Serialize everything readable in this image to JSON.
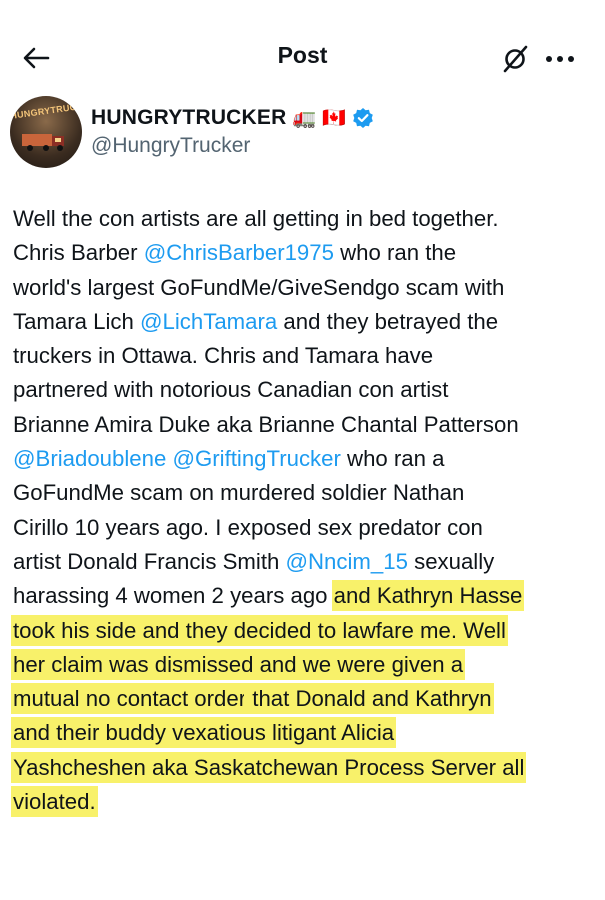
{
  "header": {
    "title": "Post",
    "back_icon": "arrow-left-icon",
    "grok_icon": "grok-icon",
    "more_icon": "more-icon"
  },
  "author": {
    "display_name": "HUNGRYTRUCKER",
    "emoji_truck": "🚛",
    "emoji_flag": "🇨🇦",
    "handle": "@HungryTrucker",
    "avatar_text": "HUNGRYTRUCKER",
    "verified_color": "#1d9bf0"
  },
  "post": {
    "lines": [
      [
        {
          "t": "Well the con artists are all getting in bed together."
        }
      ],
      [
        {
          "t": "Chris Barber "
        },
        {
          "t": "@ChrisBarber1975",
          "m": true
        },
        {
          "t": " who ran the"
        }
      ],
      [
        {
          "t": "world's largest GoFundMe/GiveSendgo scam with"
        }
      ],
      [
        {
          "t": "Tamara Lich "
        },
        {
          "t": "@LichTamara",
          "m": true
        },
        {
          "t": " and they betrayed the"
        }
      ],
      [
        {
          "t": "truckers in Ottawa. Chris and Tamara have"
        }
      ],
      [
        {
          "t": "partnered with notorious Canadian con artist"
        }
      ],
      [
        {
          "t": "Brianne Amira Duke aka Brianne Chantal Patterson"
        }
      ],
      [
        {
          "t": "@Briadoublene",
          "m": true
        },
        {
          "t": " "
        },
        {
          "t": "@GriftingTrucker",
          "m": true
        },
        {
          "t": " who ran a"
        }
      ],
      [
        {
          "t": "GoFundMe scam on murdered soldier Nathan"
        }
      ],
      [
        {
          "t": "Cirillo 10 years ago. I exposed sex predator con"
        }
      ],
      [
        {
          "t": "artist Donald Francis Smith "
        },
        {
          "t": "@Nncim_15",
          "m": true
        },
        {
          "t": " sexually"
        }
      ],
      [
        {
          "t": "harassing 4 women 2 years ago "
        },
        {
          "t": "and Kathryn Hasse",
          "h": true
        }
      ],
      [
        {
          "t": "took his side and they decided to lawfare me. Well",
          "h": true
        }
      ],
      [
        {
          "t": "her claim was dismissed and we were given a",
          "h": true
        }
      ],
      [
        {
          "t": "mutual no contact order",
          "h": true
        },
        {
          "t": " that Donald and Kathryn",
          "h": true
        }
      ],
      [
        {
          "t": "and their buddy vexatious litigant Alicia",
          "h": true
        }
      ],
      [
        {
          "t": "Yashcheshen aka Saskatchewan Process Server all",
          "h": true
        }
      ],
      [
        {
          "t": "violated.",
          "h": true
        }
      ]
    ],
    "highlight_color": "#f8f16a",
    "mention_color": "#1d9bf0"
  }
}
